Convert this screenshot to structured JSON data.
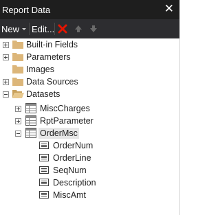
{
  "window": {
    "title": "Report Data",
    "close_glyph": "✕"
  },
  "toolbar": {
    "new_label": "New",
    "edit_label": "Edit...",
    "delete_icon": "delete-icon",
    "move_up_icon": "arrow-up-icon",
    "move_down_icon": "arrow-down-icon"
  },
  "tree": {
    "items": [
      {
        "label": "Built-in Fields",
        "icon": "folder-icon",
        "expander": "collapsed"
      },
      {
        "label": "Parameters",
        "icon": "folder-icon",
        "expander": "collapsed"
      },
      {
        "label": "Images",
        "icon": "folder-icon",
        "expander": "none"
      },
      {
        "label": "Data Sources",
        "icon": "folder-icon",
        "expander": "collapsed"
      },
      {
        "label": "Datasets",
        "icon": "folder-open-icon",
        "expander": "expanded",
        "children": [
          {
            "label": "MiscCharges",
            "icon": "dataset-icon",
            "expander": "collapsed"
          },
          {
            "label": "RptParameter",
            "icon": "dataset-icon",
            "expander": "collapsed"
          },
          {
            "label": "OrderMsc",
            "icon": "dataset-icon",
            "expander": "expanded",
            "selected": true,
            "children": [
              {
                "label": "OrderNum",
                "icon": "field-icon"
              },
              {
                "label": "OrderLine",
                "icon": "field-icon"
              },
              {
                "label": "SeqNum",
                "icon": "field-icon"
              },
              {
                "label": "Description",
                "icon": "field-icon"
              },
              {
                "label": "MiscAmt",
                "icon": "field-icon"
              }
            ]
          }
        ]
      }
    ]
  },
  "colors": {
    "titlebar": "#1e1e1e",
    "toolbar": "#2d2d30",
    "folder": "#dcb67a",
    "delete": "#e51400",
    "selection": "#e6e6e6"
  }
}
